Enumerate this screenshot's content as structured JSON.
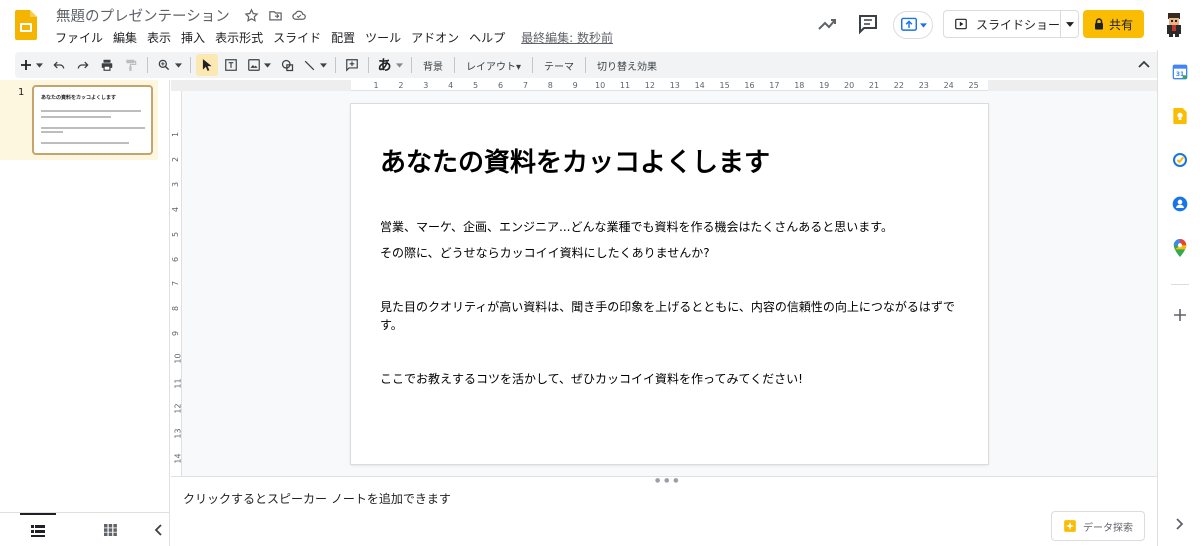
{
  "header": {
    "doc_title": "無題のプレゼンテーション",
    "menu": [
      "ファイル",
      "編集",
      "表示",
      "挿入",
      "表示形式",
      "スライド",
      "配置",
      "ツール",
      "アドオン",
      "ヘルプ"
    ],
    "last_edit": "最終編集: 数秒前",
    "slideshow_label": "スライドショー",
    "share_label": "共有"
  },
  "toolbar": {
    "input_tool_label": "あ",
    "background_label": "背景",
    "layout_label": "レイアウト▾",
    "theme_label": "テーマ",
    "transition_label": "切り替え効果"
  },
  "rulers": {
    "horizontal": [
      "1",
      "2",
      "3",
      "4",
      "5",
      "6",
      "7",
      "8",
      "9",
      "10",
      "11",
      "12",
      "13",
      "14",
      "15",
      "16",
      "17",
      "18",
      "19",
      "20",
      "21",
      "22",
      "23",
      "24",
      "25"
    ],
    "vertical": [
      "1",
      "2",
      "3",
      "4",
      "5",
      "6",
      "7",
      "8",
      "9",
      "10",
      "11",
      "12",
      "13",
      "14"
    ]
  },
  "filmstrip": {
    "slides": [
      {
        "number": "1",
        "title": "あなたの資料をカッコよくします"
      }
    ]
  },
  "slide": {
    "title": "あなたの資料をカッコよくします",
    "paragraphs": [
      "営業、マーケ、企画、エンジニア...どんな業種でも資料を作る機会はたくさんあると思います。",
      "その際に、どうせならカッコイイ資料にしたくありませんか?",
      "見た目のクオリティが高い資料は、聞き手の印象を上げるとともに、内容の信頼性の向上につながるはずです。",
      "ここでお教えするコツを活かして、ぜひカッコイイ資料を作ってみてください!"
    ]
  },
  "notes": {
    "placeholder": "クリックするとスピーカー ノートを追加できます"
  },
  "explore": {
    "label": "データ探索"
  },
  "colors": {
    "accent_yellow": "#fbbc04",
    "slides_logo": "#f4b400",
    "selected_thumb": "#fef7e0"
  }
}
